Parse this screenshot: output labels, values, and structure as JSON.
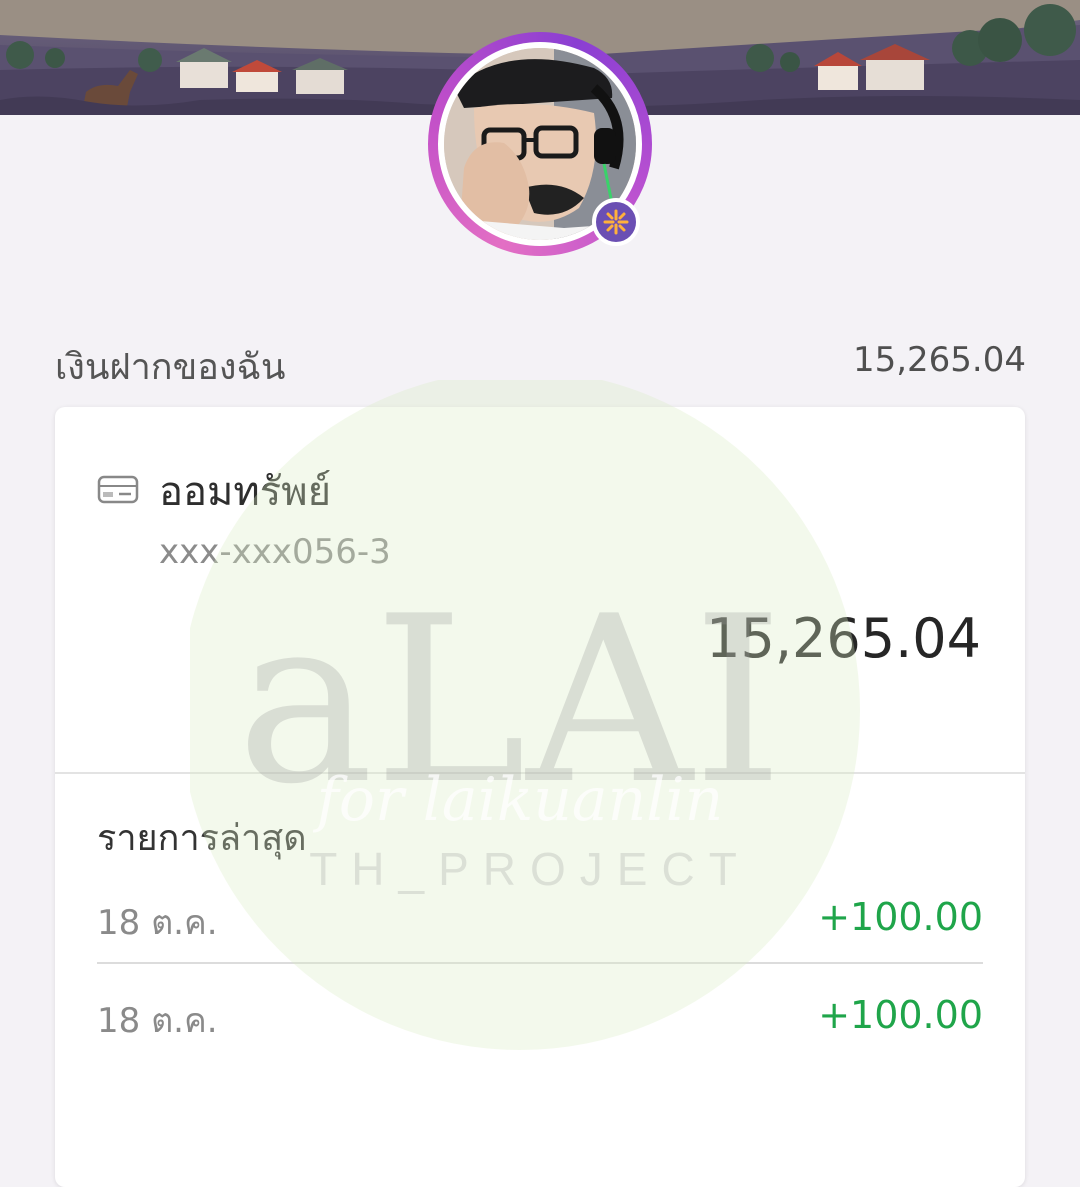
{
  "deposits": {
    "title": "เงินฝากของฉัน",
    "total": "15,265.04"
  },
  "account": {
    "type": "ออมทรัพย์",
    "number": "xxx-xxx056-3",
    "balance": "15,265.04",
    "icon": "card-icon"
  },
  "recent": {
    "title": "รายการล่าสุด",
    "transactions": [
      {
        "date": "18 ต.ค.",
        "amount": "+100.00"
      },
      {
        "date": "18 ต.ค.",
        "amount": "+100.00"
      }
    ]
  },
  "watermark": {
    "logo": "aLAI",
    "script": "for laikuanlin",
    "subtitle": "TH_PROJECT"
  },
  "colors": {
    "positive_amount": "#1fa54a",
    "avatar_ring": "#c04ec9",
    "badge": "#6b4fb3"
  }
}
